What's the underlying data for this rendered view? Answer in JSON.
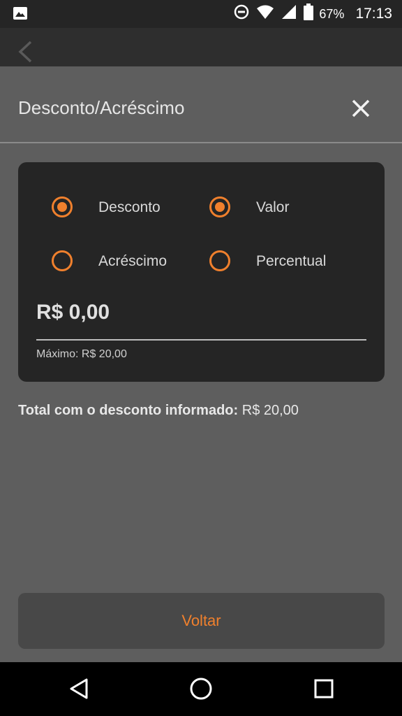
{
  "status_bar": {
    "battery_percent": "67%",
    "time": "17:13",
    "icons": [
      "image-icon",
      "do-not-disturb-icon",
      "wifi-icon",
      "signal-icon",
      "battery-icon"
    ]
  },
  "app_bar": {
    "back_icon": "chevron-left-icon"
  },
  "sheet": {
    "title": "Desconto/Acréscimo",
    "close_icon": "close-icon",
    "type_options": [
      {
        "label": "Desconto",
        "selected": true
      },
      {
        "label": "Acréscimo",
        "selected": false
      }
    ],
    "mode_options": [
      {
        "label": "Valor",
        "selected": true
      },
      {
        "label": "Percentual",
        "selected": false
      }
    ],
    "amount_value": "R$ 0,00",
    "max_text": "Máximo: R$ 20,00",
    "total_label": "Total com o desconto informado:",
    "total_value": "R$ 20,00",
    "back_button": "Voltar"
  },
  "colors": {
    "accent": "#f0802d",
    "card_bg": "#252525",
    "sheet_bg": "#5e5e5e"
  },
  "nav_bar": {
    "icons": [
      "back-triangle-icon",
      "home-circle-icon",
      "recents-square-icon"
    ]
  }
}
